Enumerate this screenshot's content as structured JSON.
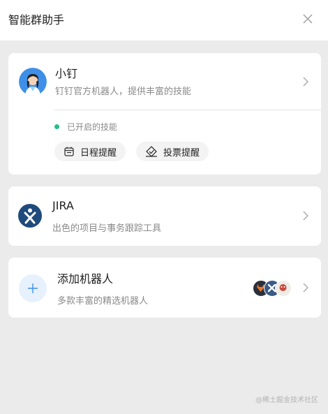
{
  "header": {
    "title": "智能群助手"
  },
  "bots": [
    {
      "name": "小钉",
      "description": "钉钉官方机器人，提供丰富的技能",
      "status": "已开启的技能",
      "skills": [
        "日程提醒",
        "投票提醒"
      ]
    },
    {
      "name": "JIRA",
      "description": "出色的项目与事务跟踪工具"
    }
  ],
  "add_bot": {
    "title": "添加机器人",
    "description": "多款丰富的精选机器人"
  },
  "watermark": "@稀土掘金技术社区",
  "colors": {
    "status_green": "#21c08c",
    "jira_blue": "#1f4a7c",
    "add_accent": "#3f8fe8"
  }
}
